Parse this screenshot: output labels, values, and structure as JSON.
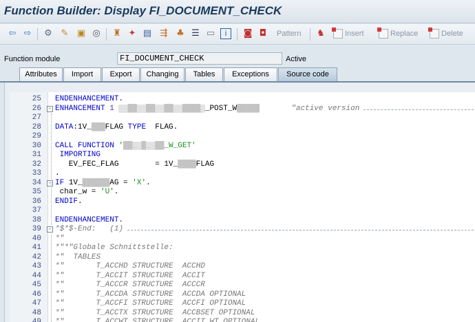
{
  "window": {
    "title": "Function Builder: Display FI_DOCUMENT_CHECK"
  },
  "toolbar": {
    "icons": [
      "back-arrow-icon",
      "forward-arrow-icon",
      "other-object-icon",
      "display-change-icon",
      "activate-icon",
      "where-used-icon",
      "check-icon",
      "test-icon",
      "object-list-icon",
      "navigation-icon",
      "enhance-icon",
      "info-icon",
      "delete-icon",
      "copy-icon"
    ],
    "pattern_label": "Pattern",
    "insert_label": "Insert",
    "replace_label": "Replace",
    "delete_label": "Delete"
  },
  "function_module": {
    "label": "Function module",
    "value": "FI_DOCUMENT_CHECK",
    "status": "Active"
  },
  "tabs": [
    {
      "label": "Attributes",
      "active": false
    },
    {
      "label": "Import",
      "active": false
    },
    {
      "label": "Export",
      "active": false
    },
    {
      "label": "Changing",
      "active": false
    },
    {
      "label": "Tables",
      "active": false
    },
    {
      "label": "Exceptions",
      "active": false
    },
    {
      "label": "Source code",
      "active": true
    }
  ],
  "code_lines": [
    {
      "n": "25",
      "parts": [
        [
          "kw",
          "ENDENHANCEMENT."
        ]
      ]
    },
    {
      "n": "26",
      "fold": "-",
      "parts": [
        [
          "kw",
          "ENHANCEMENT "
        ],
        [
          "num",
          "1 "
        ],
        [
          "blur",
          "  ██  ██  ██  ████ "
        ],
        [
          "plain",
          "_POST_W"
        ],
        [
          "blur",
          "█████"
        ],
        [
          "plain",
          "       "
        ],
        [
          "cmt",
          "\"active version"
        ]
      ],
      "dashed": true
    },
    {
      "n": "27",
      "parts": []
    },
    {
      "n": "28",
      "parts": [
        [
          "kw",
          "DATA"
        ],
        [
          "plain",
          ":1V_"
        ],
        [
          "blur",
          "███"
        ],
        [
          "plain",
          "FLAG "
        ],
        [
          "kw",
          "TYPE"
        ],
        [
          "plain",
          "  FLAG."
        ]
      ]
    },
    {
      "n": "29",
      "parts": []
    },
    {
      "n": "30",
      "parts": [
        [
          "kw",
          "CALL FUNCTION "
        ],
        [
          "str",
          "'"
        ],
        [
          "blur",
          "██_ █_ ██"
        ],
        [
          "str",
          "_W_GET'"
        ]
      ]
    },
    {
      "n": "31",
      "parts": [
        [
          "kw",
          " IMPORTING"
        ]
      ]
    },
    {
      "n": "32",
      "parts": [
        [
          "plain",
          "   EV_FEC_FLAG        = 1V_"
        ],
        [
          "blur",
          "████"
        ],
        [
          "plain",
          "FLAG"
        ]
      ]
    },
    {
      "n": "33",
      "parts": [
        [
          "plain",
          "."
        ]
      ]
    },
    {
      "n": "34",
      "fold": "-",
      "parts": [
        [
          "kw",
          "IF "
        ],
        [
          "plain",
          "1V_"
        ],
        [
          "blur",
          "██████"
        ],
        [
          "plain",
          "AG = "
        ],
        [
          "str",
          "'X'"
        ],
        [
          "plain",
          "."
        ]
      ]
    },
    {
      "n": "35",
      "parts": [
        [
          "plain",
          " char_w = "
        ],
        [
          "str",
          "'U'"
        ],
        [
          "plain",
          "."
        ]
      ]
    },
    {
      "n": "36",
      "parts": [
        [
          "kw",
          "ENDIF"
        ],
        [
          "plain",
          "."
        ]
      ]
    },
    {
      "n": "37",
      "parts": []
    },
    {
      "n": "38",
      "parts": [
        [
          "kw",
          "ENDENHANCEMENT."
        ]
      ]
    },
    {
      "n": "39",
      "fold": "-",
      "parts": [
        [
          "cmt",
          "*$*$-End:   (1)"
        ]
      ],
      "dashed": true
    },
    {
      "n": "40",
      "parts": [
        [
          "cmt",
          "*\""
        ]
      ]
    },
    {
      "n": "41",
      "parts": [
        [
          "cmt",
          "*\"*\"Globale Schnittstelle:"
        ]
      ]
    },
    {
      "n": "42",
      "parts": [
        [
          "cmt",
          "*\"  TABLES"
        ]
      ]
    },
    {
      "n": "43",
      "parts": [
        [
          "cmt",
          "*\"       T_ACCHD STRUCTURE  ACCHD"
        ]
      ]
    },
    {
      "n": "44",
      "parts": [
        [
          "cmt",
          "*\"       T_ACCIT STRUCTURE  ACCIT"
        ]
      ]
    },
    {
      "n": "45",
      "parts": [
        [
          "cmt",
          "*\"       T_ACCCR STRUCTURE  ACCCR"
        ]
      ]
    },
    {
      "n": "46",
      "parts": [
        [
          "cmt",
          "*\"       T_ACCDA STRUCTURE  ACCDA OPTIONAL"
        ]
      ]
    },
    {
      "n": "47",
      "parts": [
        [
          "cmt",
          "*\"       T_ACCFI STRUCTURE  ACCFI OPTIONAL"
        ]
      ]
    },
    {
      "n": "48",
      "parts": [
        [
          "cmt",
          "*\"       T_ACCTX STRUCTURE  ACCBSET OPTIONAL"
        ]
      ]
    },
    {
      "n": "49",
      "parts": [
        [
          "cmt",
          "*\"       T_ACCWT STRUCTURE  ACCIT_WT OPTIONAL"
        ]
      ]
    }
  ]
}
